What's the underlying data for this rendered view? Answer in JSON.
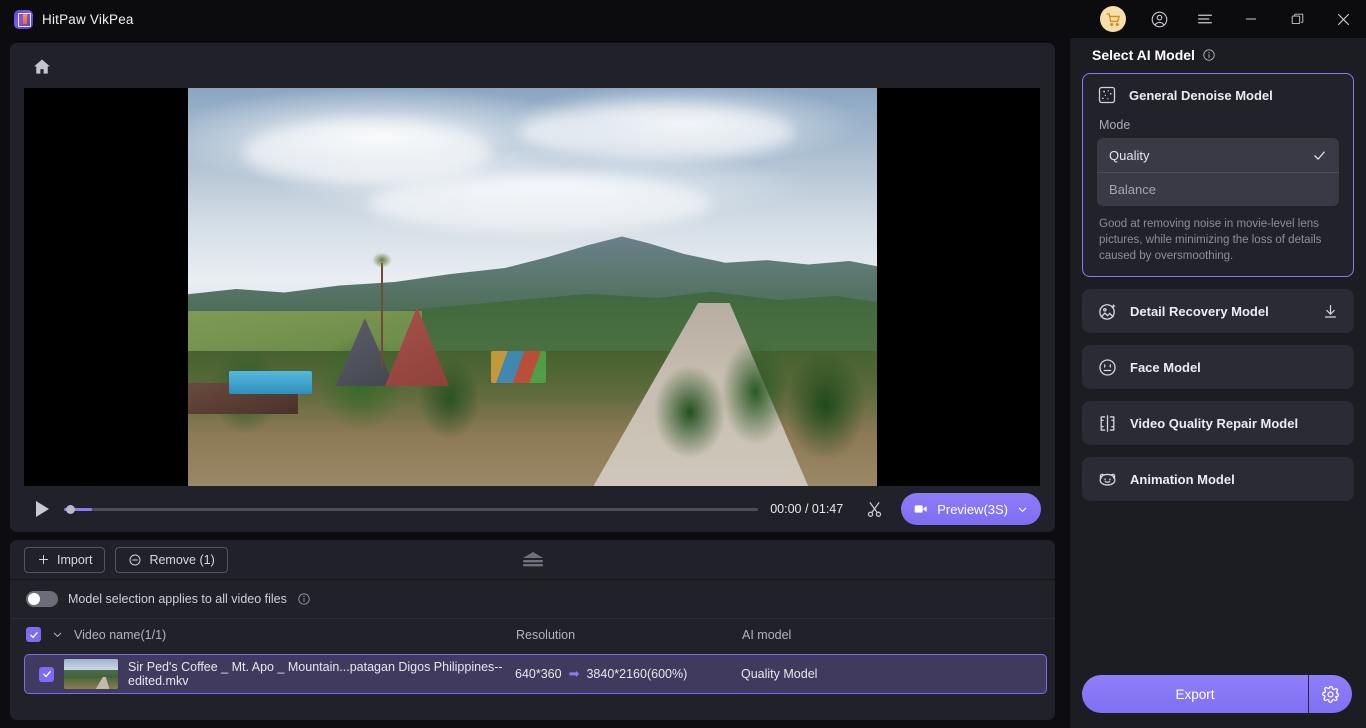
{
  "app": {
    "title": "HitPaw VikPea",
    "logo_icon": "hitpaw-logo-icon"
  },
  "titlebar": {
    "buttons": [
      {
        "name": "cart-icon",
        "label": ""
      },
      {
        "name": "account-icon",
        "label": ""
      },
      {
        "name": "menu-icon",
        "label": ""
      },
      {
        "name": "minimize-icon",
        "label": ""
      },
      {
        "name": "maximize-icon",
        "label": ""
      },
      {
        "name": "close-icon",
        "label": ""
      }
    ]
  },
  "player": {
    "home_icon": "home-icon",
    "play_icon": "play-icon",
    "progress_percent": 4,
    "time": "00:00 / 01:47",
    "cut_icon": "scissors-icon",
    "preview_label": "Preview(3S)",
    "preview_icon": "video-camera-icon",
    "preview_chevron": "chevron-down-icon"
  },
  "toolbar": {
    "import_label": "Import",
    "import_icon": "plus-icon",
    "remove_label": "Remove (1)",
    "remove_icon": "minus-circle-icon",
    "collapse_icon": "collapse-panel-icon"
  },
  "apply_all": {
    "label": "Model selection applies to all video files",
    "info_icon": "info-icon",
    "enabled": false
  },
  "file_list": {
    "columns": {
      "name": "Video name(1/1)",
      "resolution": "Resolution",
      "ai_model": "AI model"
    },
    "header_chevron": "chevron-down-icon",
    "rows": [
      {
        "selected": true,
        "thumbnail": "video-thumbnail",
        "name": "Sir Ped's Coffee _ Mt. Apo _ Mountain...patagan Digos Philippines--edited.mkv",
        "resolution_from": "640*360",
        "resolution_arrow": "➡",
        "resolution_to": "3840*2160(600%)",
        "ai_model": "Quality Model"
      }
    ]
  },
  "sidebar": {
    "title": "Select AI Model",
    "title_info_icon": "info-icon",
    "models": [
      {
        "id": "general-denoise",
        "label": "General Denoise Model",
        "icon": "denoise-icon",
        "selected": true,
        "mode_label": "Mode",
        "modes": [
          {
            "label": "Quality",
            "checked": true
          },
          {
            "label": "Balance",
            "checked": false
          }
        ],
        "description": "Good at removing noise in movie-level lens pictures, while minimizing the loss of details caused by oversmoothing."
      },
      {
        "id": "detail-recovery",
        "label": "Detail Recovery Model",
        "icon": "detail-recovery-icon",
        "selected": false,
        "download_icon": "download-icon"
      },
      {
        "id": "face-model",
        "label": "Face Model",
        "icon": "face-icon",
        "selected": false
      },
      {
        "id": "video-quality-repair",
        "label": "Video Quality Repair Model",
        "icon": "video-repair-icon",
        "selected": false
      },
      {
        "id": "animation-model",
        "label": "Animation Model",
        "icon": "animation-bear-icon",
        "selected": false
      }
    ],
    "export_label": "Export",
    "export_settings_icon": "gear-icon"
  },
  "colors": {
    "accent_purple": "#8b7af5",
    "app_background": "#0d0d11",
    "panel_background": "#212129",
    "sidebar_background": "#1c1c23",
    "card_background": "#2b2b35",
    "cart_badge": "#f5dfa8"
  }
}
